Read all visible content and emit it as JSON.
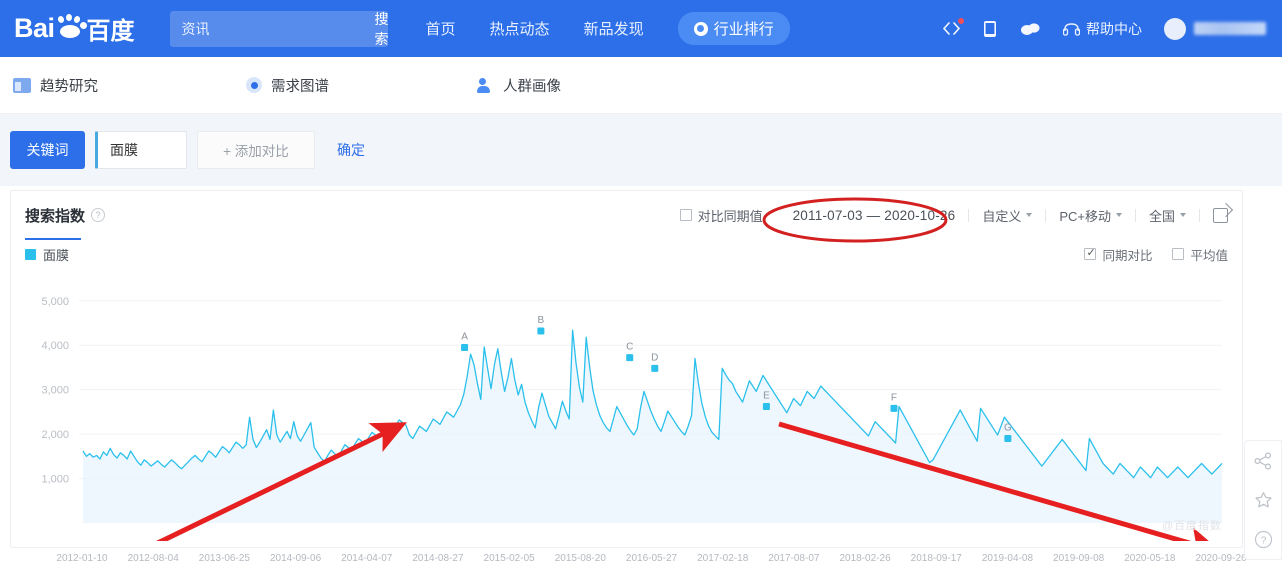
{
  "header": {
    "logo_text": "Bai",
    "logo_cn": "百度",
    "search": {
      "value": "资讯",
      "placeholder": "资讯",
      "button_label": "搜索"
    },
    "nav": [
      {
        "label": "首页",
        "icon": "",
        "active": false
      },
      {
        "label": "热点动态",
        "icon": "",
        "active": false
      },
      {
        "label": "新品发现",
        "icon": "",
        "active": false
      },
      {
        "label": "行业排行",
        "icon": "compass-icon",
        "active": true
      }
    ],
    "icons": [
      "code-icon",
      "mobile-icon",
      "cloud-icon"
    ],
    "help_label": "帮助中心",
    "help_icon": "headset-icon",
    "user_name": "用户名"
  },
  "subnav": {
    "items": [
      {
        "label": "趋势研究",
        "icon": "chart-icon"
      },
      {
        "label": "需求图谱",
        "icon": "radar-icon"
      },
      {
        "label": "人群画像",
        "icon": "user-icon"
      }
    ]
  },
  "toolbar": {
    "keyword_button": "关键词",
    "keyword_value": "面膜",
    "add_compare": "+ 添加对比",
    "confirm": "确定"
  },
  "card": {
    "title": "搜索指数",
    "info_icon": "info-icon",
    "compare_checkbox": {
      "label": "对比同期值",
      "checked": false
    },
    "date_range": "2011-07-03 — 2020-10-26",
    "date_preset": "自定义",
    "device": "PC+移动",
    "region": "全国",
    "share_icon": "share-external-icon",
    "legend": [
      {
        "label": "面膜",
        "color": "#2bc0ec"
      }
    ],
    "legend_right": [
      {
        "label": "同期对比",
        "checked": true
      },
      {
        "label": "平均值",
        "checked": false
      }
    ],
    "watermark": "@百度指数"
  },
  "dock": {
    "items": [
      {
        "icon": "share-nodes-icon",
        "label": "分享"
      },
      {
        "icon": "star-icon",
        "label": "收藏"
      },
      {
        "icon": "question-circle-icon",
        "label": "帮助"
      }
    ]
  },
  "annotations": {
    "red_ellipse": {
      "target": "date_range"
    },
    "up_arrow": {
      "meaning": "上升趋势"
    },
    "down_arrow": {
      "meaning": "下降趋势"
    }
  },
  "chart_data": {
    "type": "line",
    "title": "搜索指数",
    "xlabel": "",
    "ylabel": "",
    "ylim": [
      0,
      5400
    ],
    "grid": true,
    "legend_position": "top-left",
    "series_color": "#2bc0ec",
    "area_fill": "#eaf4fd",
    "yticks": [
      "1,000",
      "2,000",
      "3,000",
      "4,000",
      "5,000"
    ],
    "ytick_values": [
      1000,
      2000,
      3000,
      4000,
      5000
    ],
    "xticks": [
      "2012-01-10",
      "2012-08-04",
      "2013-06-25",
      "2014-09-06",
      "2014-04-07",
      "2014-08-27",
      "2015-02-05",
      "2015-08-20",
      "2016-05-27",
      "2017-02-18",
      "2017-08-07",
      "2018-02-26",
      "2018-09-17",
      "2019-04-08",
      "2019-09-08",
      "2020-05-18",
      "2020-09-26"
    ],
    "point_markers": [
      {
        "label": "A",
        "x_frac": 0.335,
        "value": 3950
      },
      {
        "label": "B",
        "x_frac": 0.402,
        "value": 4320
      },
      {
        "label": "C",
        "x_frac": 0.48,
        "value": 3720
      },
      {
        "label": "D",
        "x_frac": 0.502,
        "value": 3480
      },
      {
        "label": "E",
        "x_frac": 0.6,
        "value": 2620
      },
      {
        "label": "F",
        "x_frac": 0.712,
        "value": 2580
      },
      {
        "label": "G",
        "x_frac": 0.812,
        "value": 1900
      }
    ],
    "x_range": [
      "2011-07-03",
      "2020-10-26"
    ],
    "values": [
      1620,
      1500,
      1560,
      1480,
      1520,
      1440,
      1600,
      1520,
      1680,
      1540,
      1460,
      1580,
      1520,
      1440,
      1620,
      1500,
      1380,
      1300,
      1420,
      1360,
      1280,
      1340,
      1400,
      1320,
      1260,
      1340,
      1420,
      1360,
      1280,
      1220,
      1300,
      1380,
      1460,
      1520,
      1440,
      1380,
      1500,
      1620,
      1560,
      1480,
      1600,
      1720,
      1660,
      1580,
      1700,
      1820,
      1760,
      1680,
      1760,
      2380,
      1880,
      1700,
      1820,
      1960,
      2100,
      1880,
      2540,
      1980,
      1820,
      1940,
      2060,
      1900,
      2280,
      1960,
      1840,
      1980,
      2120,
      2260,
      1700,
      1580,
      1460,
      1380,
      1520,
      1640,
      1560,
      1480,
      1620,
      1760,
      1700,
      1640,
      1780,
      1900,
      1840,
      1780,
      1920,
      2040,
      1980,
      1920,
      2060,
      2180,
      2120,
      2060,
      2200,
      2320,
      2260,
      2200,
      1980,
      1900,
      2040,
      2180,
      2120,
      2060,
      2200,
      2340,
      2280,
      2220,
      2360,
      2500,
      2440,
      2380,
      2520,
      2660,
      2900,
      3300,
      3800,
      3560,
      3140,
      2780,
      3960,
      3480,
      3020,
      3560,
      3920,
      3400,
      2960,
      3280,
      3700,
      3220,
      2880,
      3120,
      2720,
      2480,
      2300,
      2140,
      2600,
      2920,
      2660,
      2400,
      2260,
      2120,
      2420,
      2740,
      2520,
      2340,
      4340,
      3600,
      3060,
      2720,
      4180,
      3520,
      2980,
      2660,
      2420,
      2260,
      2140,
      2060,
      2340,
      2620,
      2480,
      2340,
      2200,
      2080,
      1980,
      2120,
      2600,
      2960,
      2740,
      2520,
      2340,
      2180,
      2060,
      2280,
      2520,
      2400,
      2280,
      2160,
      2060,
      1980,
      2180,
      2420,
      3700,
      3140,
      2700,
      2400,
      2180,
      2040,
      1960,
      1880,
      3480,
      3340,
      3220,
      3140,
      2960,
      2840,
      2720,
      2960,
      3200,
      3080,
      2960,
      3140,
      3320,
      3200,
      3080,
      2960,
      2840,
      2720,
      2600,
      2480,
      2640,
      2800,
      2720,
      2640,
      2800,
      2960,
      2880,
      2800,
      2940,
      3080,
      3000,
      2920,
      2840,
      2760,
      2680,
      2600,
      2520,
      2440,
      2360,
      2280,
      2200,
      2120,
      2040,
      1960,
      2120,
      2280,
      2200,
      2120,
      2040,
      1960,
      1880,
      1800,
      2620,
      2480,
      2340,
      2200,
      2060,
      1920,
      1780,
      1640,
      1500,
      1360,
      1420,
      1560,
      1700,
      1840,
      1980,
      2120,
      2260,
      2400,
      2540,
      2400,
      2260,
      2120,
      1980,
      1840,
      2580,
      2460,
      2340,
      2220,
      2100,
      1980,
      2180,
      2380,
      2280,
      2180,
      2080,
      1980,
      1880,
      1780,
      1680,
      1580,
      1480,
      1380,
      1280,
      1380,
      1480,
      1580,
      1680,
      1780,
      1880,
      1780,
      1680,
      1580,
      1480,
      1380,
      1280,
      1180,
      1900,
      1760,
      1620,
      1480,
      1340,
      1260,
      1180,
      1100,
      1220,
      1340,
      1260,
      1180,
      1100,
      1020,
      1140,
      1260,
      1180,
      1100,
      1020,
      1140,
      1260,
      1180,
      1100,
      1020,
      1100,
      1180,
      1260,
      1180,
      1100,
      1020,
      1100,
      1180,
      1260,
      1340,
      1260,
      1180,
      1100,
      1180,
      1260,
      1340
    ]
  }
}
